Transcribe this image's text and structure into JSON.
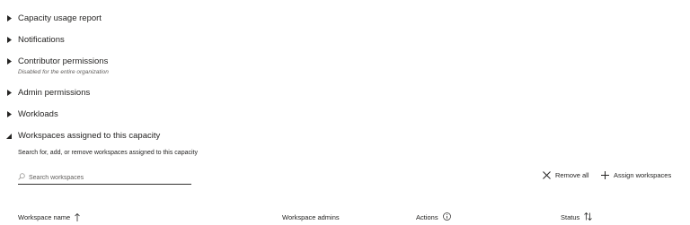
{
  "sections": [
    {
      "title": "Capacity usage report",
      "expanded": false
    },
    {
      "title": "Notifications",
      "expanded": false
    },
    {
      "title": "Contributor permissions",
      "subtitle": "Disabled for the entire organization",
      "expanded": false
    },
    {
      "title": "Admin permissions",
      "expanded": false
    },
    {
      "title": "Workloads",
      "expanded": false
    },
    {
      "title": "Workspaces assigned to this capacity",
      "expanded": true
    }
  ],
  "workspaces": {
    "description": "Search for, add, or remove workspaces assigned to this capacity",
    "search_placeholder": "Search workspaces",
    "remove_all_label": "Remove all",
    "assign_label": "Assign workspaces",
    "columns": {
      "name": "Workspace name",
      "admins": "Workspace admins",
      "actions": "Actions",
      "status": "Status"
    }
  },
  "icons": {
    "collapsed": "caret-right-icon",
    "expanded": "caret-down-icon",
    "search": "search-icon",
    "remove": "close-icon",
    "assign": "plus-icon",
    "sort_asc": "sort-up-icon",
    "info": "info-icon",
    "sort_both": "sort-both-icon"
  }
}
